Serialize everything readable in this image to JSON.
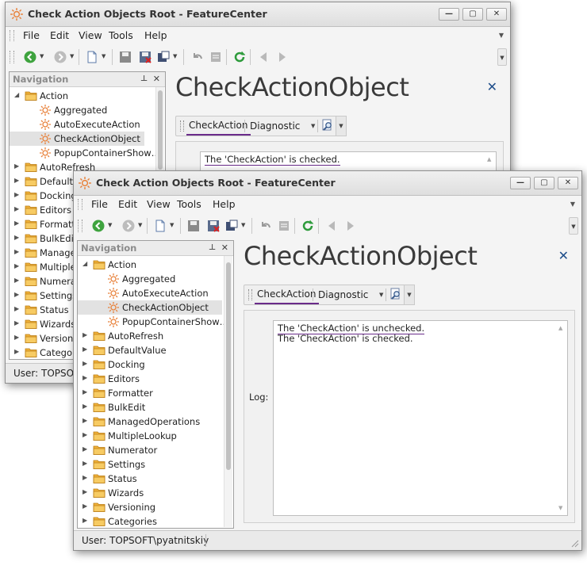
{
  "windows": [
    {
      "title": "Check Action Objects Root - FeatureCenter",
      "controls": {
        "minimize": "—",
        "maximize": "▢",
        "close": "✕"
      },
      "menu": [
        "File",
        "Edit",
        "View",
        "Tools",
        "Help"
      ],
      "navigation": {
        "header": "Navigation",
        "pin": "⊥",
        "close": "✕",
        "items": [
          {
            "label": "Action",
            "level": 0,
            "expanded": true
          },
          {
            "label": "Aggregated",
            "level": 1
          },
          {
            "label": "AutoExecuteAction",
            "level": 1
          },
          {
            "label": "CheckActionObject",
            "level": 1,
            "selected": true
          },
          {
            "label": "PopupContainerShow…",
            "level": 1
          },
          {
            "label": "AutoRefresh",
            "level": 0
          },
          {
            "label": "DefaultV",
            "level": 0
          },
          {
            "label": "Docking",
            "level": 0
          },
          {
            "label": "Editors",
            "level": 0
          },
          {
            "label": "Formatt",
            "level": 0
          },
          {
            "label": "BulkEdit",
            "level": 0
          },
          {
            "label": "Manage",
            "level": 0
          },
          {
            "label": "MultipleL",
            "level": 0
          },
          {
            "label": "Numera",
            "level": 0
          },
          {
            "label": "Settings",
            "level": 0
          },
          {
            "label": "Status",
            "level": 0
          },
          {
            "label": "Wizards",
            "level": 0
          },
          {
            "label": "Versionin",
            "level": 0
          },
          {
            "label": "Categor",
            "level": 0
          }
        ]
      },
      "view_title": "CheckActionObject",
      "actions": {
        "check": "CheckAction",
        "diagnostic": "Diagnostic"
      },
      "log": {
        "label": "",
        "lines": [
          "The 'CheckAction' is checked."
        ]
      },
      "status": "User: TOPSOFT"
    },
    {
      "title": "Check Action Objects Root - FeatureCenter",
      "controls": {
        "minimize": "—",
        "maximize": "▢",
        "close": "✕"
      },
      "menu": [
        "File",
        "Edit",
        "View",
        "Tools",
        "Help"
      ],
      "navigation": {
        "header": "Navigation",
        "pin": "⊥",
        "close": "✕",
        "items": [
          {
            "label": "Action",
            "level": 0,
            "expanded": true
          },
          {
            "label": "Aggregated",
            "level": 1
          },
          {
            "label": "AutoExecuteAction",
            "level": 1
          },
          {
            "label": "CheckActionObject",
            "level": 1,
            "selected": true
          },
          {
            "label": "PopupContainerShow…",
            "level": 1
          },
          {
            "label": "AutoRefresh",
            "level": 0
          },
          {
            "label": "DefaultValue",
            "level": 0
          },
          {
            "label": "Docking",
            "level": 0
          },
          {
            "label": "Editors",
            "level": 0
          },
          {
            "label": "Formatter",
            "level": 0
          },
          {
            "label": "BulkEdit",
            "level": 0
          },
          {
            "label": "ManagedOperations",
            "level": 0
          },
          {
            "label": "MultipleLookup",
            "level": 0
          },
          {
            "label": "Numerator",
            "level": 0
          },
          {
            "label": "Settings",
            "level": 0
          },
          {
            "label": "Status",
            "level": 0
          },
          {
            "label": "Wizards",
            "level": 0
          },
          {
            "label": "Versioning",
            "level": 0
          },
          {
            "label": "Categories",
            "level": 0
          }
        ]
      },
      "view_title": "CheckActionObject",
      "actions": {
        "check": "CheckAction",
        "diagnostic": "Diagnostic"
      },
      "log": {
        "label": "Log:",
        "lines": [
          "The 'CheckAction' is unchecked.",
          "The 'CheckAction' is checked."
        ]
      },
      "status": "User: TOPSOFT\\pyatnitskiy"
    }
  ],
  "colors": {
    "accent_underline": "#6a2b8a",
    "folder": "#f0b23a",
    "gear": "#e8813a",
    "close_view": "#1f4e8a"
  }
}
